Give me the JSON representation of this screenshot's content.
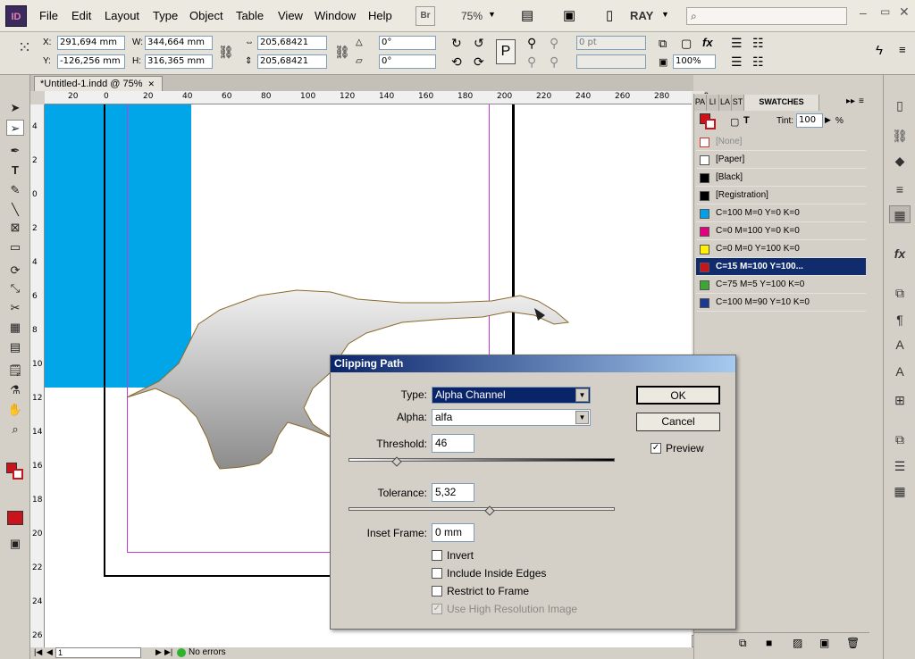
{
  "app": {
    "logo": "ID"
  },
  "menu": [
    "File",
    "Edit",
    "Layout",
    "Type",
    "Object",
    "Table",
    "View",
    "Window",
    "Help"
  ],
  "menubar": {
    "br_label": "Br",
    "zoom": "75%",
    "workspace": "RAY",
    "search_placeholder": ""
  },
  "control": {
    "x_label": "X:",
    "x": "291,694 mm",
    "y_label": "Y:",
    "y": "-126,256 mm",
    "w_label": "W:",
    "w": "344,664 mm",
    "h_label": "H:",
    "h": "316,365 mm",
    "scale_x": "205,68421",
    "scale_y": "205,68421",
    "rotate": "0°",
    "shear": "0°",
    "stroke": "0 pt",
    "opacity": "100%"
  },
  "document": {
    "tab_title": "*Untitled-1.indd @ 75%",
    "hruler": [
      "20",
      "0",
      "20",
      "40",
      "60",
      "80",
      "100",
      "120",
      "140",
      "160",
      "180",
      "200",
      "220",
      "240",
      "260",
      "280",
      "300"
    ],
    "vruler": [
      "4",
      "2",
      "0",
      "2",
      "4",
      "6",
      "8",
      "10",
      "12",
      "14",
      "16",
      "18",
      "20",
      "22",
      "24",
      "26"
    ]
  },
  "status": {
    "page": "1",
    "errors": "No errors"
  },
  "swatches_panel": {
    "tabs": [
      "PA",
      "LI",
      "LA",
      "ST",
      "SWATCHES"
    ],
    "tint_label": "Tint:",
    "tint_value": "100",
    "tint_unit": "%",
    "items": [
      {
        "name": "[None]",
        "color": "#ffffff"
      },
      {
        "name": "[Paper]",
        "color": "#ffffff"
      },
      {
        "name": "[Black]",
        "color": "#000000"
      },
      {
        "name": "[Registration]",
        "color": "#000000"
      },
      {
        "name": "C=100 M=0 Y=0 K=0",
        "color": "#00a0e9"
      },
      {
        "name": "C=0 M=100 Y=0 K=0",
        "color": "#e4007f"
      },
      {
        "name": "C=0 M=0 Y=100 K=0",
        "color": "#fff100"
      },
      {
        "name": "C=15 M=100 Y=100...",
        "color": "#c9141c"
      },
      {
        "name": "C=75 M=5 Y=100 K=0",
        "color": "#3ca536"
      },
      {
        "name": "C=100 M=90 Y=10 K=0",
        "color": "#1d3a8f"
      }
    ]
  },
  "dialog": {
    "title": "Clipping Path",
    "type_label": "Type:",
    "type_value": "Alpha Channel",
    "alpha_label": "Alpha:",
    "alpha_value": "alfa",
    "threshold_label": "Threshold:",
    "threshold_value": "46",
    "tolerance_label": "Tolerance:",
    "tolerance_value": "5,32",
    "inset_label": "Inset Frame:",
    "inset_value": "0 mm",
    "invert": "Invert",
    "inside_edges": "Include Inside Edges",
    "restrict": "Restrict to Frame",
    "highres": "Use High Resolution Image",
    "ok": "OK",
    "cancel": "Cancel",
    "preview": "Preview",
    "threshold_level": 0.18,
    "tolerance_level": 0.53
  }
}
